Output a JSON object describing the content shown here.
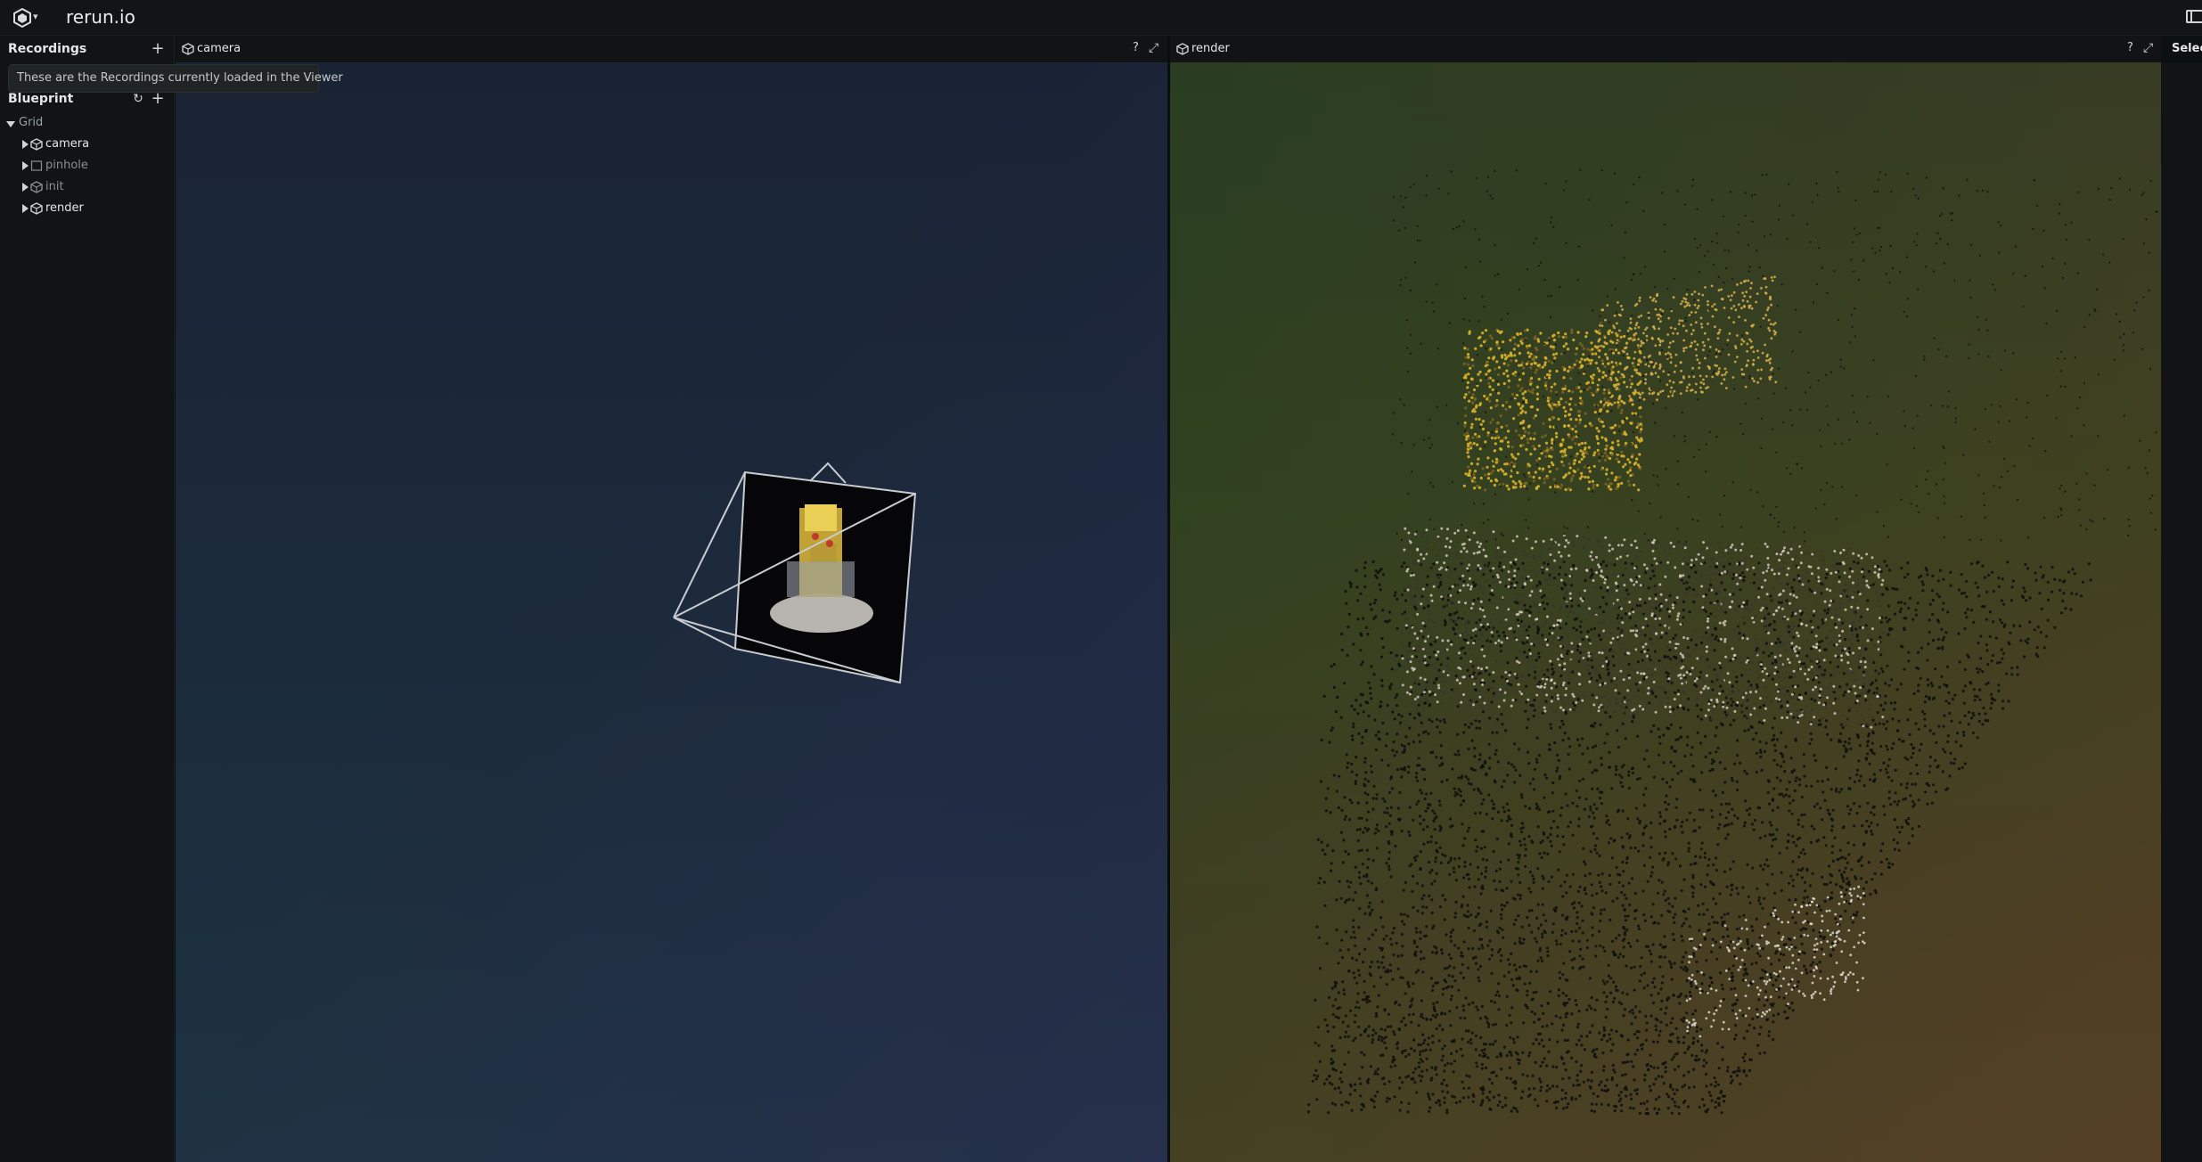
{
  "app": {
    "title": "rerun.io",
    "logo_icon": "rerun-logo-icon",
    "panel_toggle_icon": "side-panel-icon"
  },
  "recordings": {
    "title": "Recordings",
    "add_icon": "plus-icon",
    "tooltip": "These are the Recordings currently loaded in the Viewer"
  },
  "blueprint": {
    "title": "Blueprint",
    "reset_icon": "reset-icon",
    "add_icon": "plus-icon",
    "tree": [
      {
        "label": "Grid",
        "expanded": true,
        "icon": "none",
        "level": 0
      },
      {
        "label": "camera",
        "expanded": false,
        "icon": "3d-view-icon",
        "level": 1
      },
      {
        "label": "pinhole",
        "expanded": false,
        "icon": "2d-view-icon",
        "level": 1,
        "dimmed": true
      },
      {
        "label": "init",
        "expanded": false,
        "icon": "3d-view-icon",
        "level": 1,
        "dimmed": true
      },
      {
        "label": "render",
        "expanded": false,
        "icon": "3d-view-icon",
        "level": 1
      }
    ]
  },
  "views": [
    {
      "title": "camera",
      "icon": "3d-view-icon",
      "help": "?",
      "maximize_icon": "maximize-icon"
    },
    {
      "title": "render",
      "icon": "3d-view-icon",
      "help": "?",
      "maximize_icon": "maximize-icon"
    }
  ],
  "selection_panel": {
    "title": "Selection"
  },
  "colors": {
    "background": "#0d1011",
    "panel": "#111314",
    "camera_view_bg": "#1b2b3a",
    "render_view_bg": "#3a4024",
    "frustum_line": "#c8ccd0"
  }
}
